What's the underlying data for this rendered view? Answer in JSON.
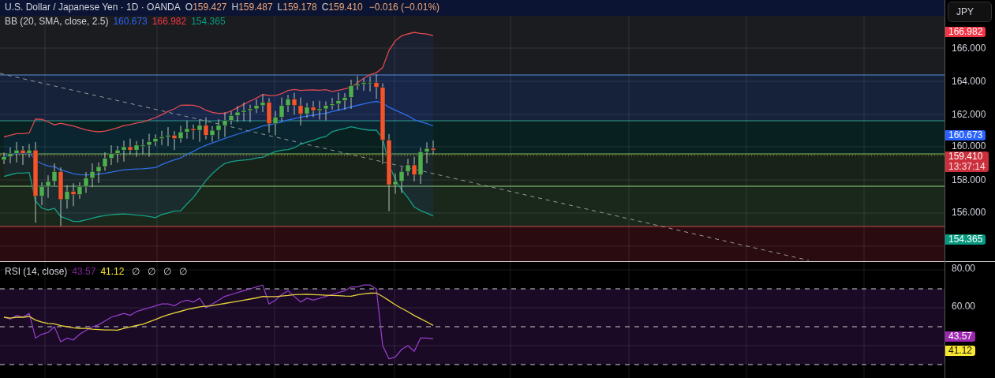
{
  "legend": {
    "symbol": "U.S. Dollar / Japanese Yen · 1D · OANDA",
    "ohlc": [
      {
        "label": "O",
        "value": "159.427"
      },
      {
        "label": "H",
        "value": "159.487"
      },
      {
        "label": "L",
        "value": "159.178"
      },
      {
        "label": "C",
        "value": "159.410"
      }
    ],
    "change": "−0.016 (−0.01%)"
  },
  "bollinger": {
    "name": "BB (20, SMA, close, 2.5)",
    "values": [
      {
        "text": "160.673",
        "color": "#2962ff"
      },
      {
        "text": "166.982",
        "color": "#f23645"
      },
      {
        "text": "154.365",
        "color": "#089981"
      }
    ]
  },
  "rsi": {
    "name": "RSI (14, close)",
    "values": [
      {
        "text": "43.57",
        "color": "#7e1f9c"
      },
      {
        "text": "41.12",
        "color": "#f7e733"
      }
    ],
    "extras": [
      "∅",
      "∅",
      "∅",
      "∅"
    ]
  },
  "price_axis": {
    "currency": "JPY",
    "ticks": [
      "166.000",
      "164.000",
      "162.000",
      "160.000",
      "158.000",
      "156.000"
    ],
    "labels": [
      {
        "text": "166.982",
        "color": "#f23645"
      },
      {
        "text": "160.673",
        "color": "#2962ff"
      },
      {
        "text": "159.410",
        "subtext": "13:37:14",
        "color": "#cc2f3c"
      },
      {
        "text": "154.365",
        "color": "#089981"
      }
    ]
  },
  "rsi_axis": {
    "ticks": [
      "80.00",
      "60.00"
    ],
    "labels": [
      {
        "text": "43.57",
        "color": "#9c27b0"
      },
      {
        "text": "41.12",
        "color": "#f7e733"
      }
    ]
  }
}
